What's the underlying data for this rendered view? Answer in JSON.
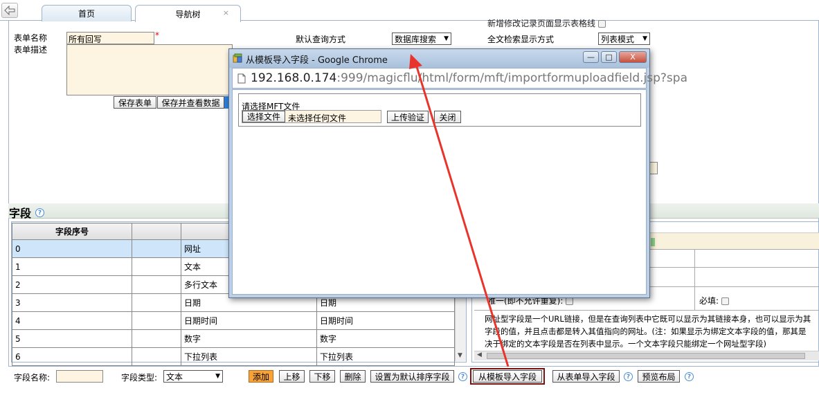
{
  "tabs": {
    "home": "首页",
    "nav_tree": "导航树",
    "close_glyph": "×"
  },
  "form": {
    "name_label": "表单名称",
    "name_value": "所有回写",
    "required_mark": "*",
    "desc_label": "表单描述",
    "save_form": "保存表单",
    "save_and_view": "保存并查看数据",
    "default_query_label": "默认查询方式",
    "default_query_value": "数据库搜索",
    "fulltext_label": "全文检索显示方式",
    "fulltext_value": "列表模式",
    "new_edit_gridline_label": "新增修改记录页面显示表格线"
  },
  "fields_section": {
    "title": "字段",
    "columns": [
      "字段序号",
      "",
      "",
      ""
    ],
    "rows": [
      {
        "index": "0",
        "name": "",
        "type": "网址",
        "extra": ""
      },
      {
        "index": "1",
        "name": "",
        "type": "文本",
        "extra": ""
      },
      {
        "index": "2",
        "name": "",
        "type": "多行文本",
        "extra": ""
      },
      {
        "index": "3",
        "name": "",
        "type": "日期",
        "extra": "日期"
      },
      {
        "index": "4",
        "name": "",
        "type": "日期时间",
        "extra": "日期时间"
      },
      {
        "index": "5",
        "name": "",
        "type": "数字",
        "extra": "数字"
      },
      {
        "index": "6",
        "name": "",
        "type": "下拉列表",
        "extra": "下拉列表"
      }
    ]
  },
  "right_panel": {
    "unique_label": "唯一(即不允许重复):",
    "required_label": "必填:",
    "desc_line1": "网址型字段是一个URL链接，但是在查询列表中它既可以显示为其链接本身，也可以显示为其",
    "desc_line2": "字段的值，并且点击都是转入其值指向的网址。(注：如果显示为绑定文本字段的值，那其是",
    "desc_line3": "决于绑定的文本字段是否在列表中显示。一个文本字段只能绑定一个网址型字段)"
  },
  "bottom_bar": {
    "field_name_label": "字段名称:",
    "field_type_label": "字段类型:",
    "field_type_value": "文本",
    "add": "添加",
    "move_up": "上移",
    "move_down": "下移",
    "delete": "删除",
    "set_default_sort": "设置为默认排序字段",
    "import_from_template": "从模板导入字段",
    "import_from_form": "从表单导入字段",
    "preview_layout": "预览布局"
  },
  "popup": {
    "title": "从模板导入字段 - Google Chrome",
    "url_host": "192.168.0.174",
    "url_rest": ":999/magicflu/html/form/mft/importformuploadfield.jsp?spa",
    "prompt": "请选择MFT文件",
    "choose_file": "选择文件",
    "no_file": "未选择任何文件",
    "upload_verify": "上传验证",
    "close": "关闭",
    "minimize_glyph": "—",
    "maximize_glyph": "□",
    "close_glyph": "X"
  },
  "colors": {
    "accent_orange": "#f7a23a",
    "selected_row": "#cfe6fa",
    "input_bg": "#fdf5e1",
    "arrow_red": "#e8342a",
    "highlight_border": "#7a1010"
  }
}
